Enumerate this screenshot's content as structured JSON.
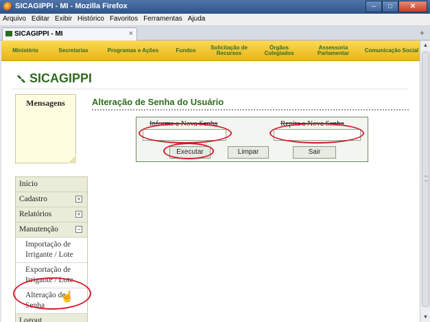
{
  "window": {
    "title": "SICAGIPPI - MI - Mozilla Firefox",
    "min": "–",
    "max": "□",
    "close": "✕"
  },
  "menubar": [
    "Arquivo",
    "Editar",
    "Exibir",
    "Histórico",
    "Favoritos",
    "Ferramentas",
    "Ajuda"
  ],
  "tab": {
    "label": "SICAGIPPI - MI",
    "close": "×",
    "new": "+"
  },
  "nav": [
    "Ministério",
    "Secretarias",
    "Programas e Ações",
    "Fundos",
    "Solicitação de Recursos",
    "Órgãos Colegiados",
    "Assessoria Parlamentar",
    "Comunicação Social"
  ],
  "brand": {
    "name": "SICAGIPPI"
  },
  "messages": {
    "title": "Mensagens"
  },
  "leftmenu": {
    "items": [
      {
        "label": "Início",
        "exp": ""
      },
      {
        "label": "Cadastro",
        "exp": "+"
      },
      {
        "label": "Relatórios",
        "exp": "+"
      },
      {
        "label": "Manutenção",
        "exp": "−"
      }
    ],
    "subitems": [
      "Importação de Irrigante / Lote",
      "Exportação de Irrigante / Lote",
      "Alteração de Senha"
    ],
    "logout": "Logout"
  },
  "content": {
    "title": "Alteração de Senha do Usuário",
    "new_password_label": "Informe a Nova Senha",
    "repeat_password_label": "Repita a Nova Senha",
    "new_password_value": "",
    "repeat_password_value": "",
    "execute": "Executar",
    "clear": "Limpar",
    "exit": "Sair"
  },
  "colors": {
    "accent_green": "#2e6b1f",
    "nav_yellow": "#f2c630",
    "highlight_red": "#d4182a"
  }
}
